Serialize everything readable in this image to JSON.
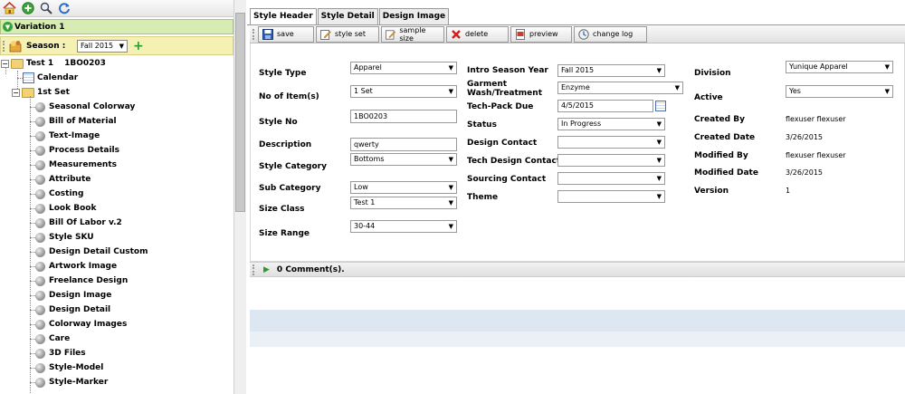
{
  "nav": {
    "icons": [
      "home-icon",
      "add-icon",
      "search-icon",
      "refresh-icon"
    ],
    "variation_label": "Variation 1",
    "season_label": "Season :",
    "season_value": "Fall 2015"
  },
  "tree": {
    "root_label": "Test 1",
    "root_code": "1BO0203",
    "calendar_label": "Calendar",
    "set_label": "1st Set",
    "items": [
      "Seasonal Colorway",
      "Bill of Material",
      "Text-Image",
      "Process Details",
      "Measurements",
      "Attribute",
      "Costing",
      "Look Book",
      "Bill Of Labor v.2",
      "Style SKU",
      "Design Detail Custom",
      "Artwork Image",
      "Freelance Design",
      "Design Image",
      "Design Detail",
      "Colorway Images",
      "Care",
      "3D Files",
      "Style-Model",
      "Style-Marker"
    ]
  },
  "tabs": [
    "Style Header",
    "Style Detail",
    "Design Image"
  ],
  "toolbar": {
    "save": "save",
    "style_set": "style set",
    "sample_size": "sample size",
    "delete": "delete",
    "preview": "preview",
    "change_log": "change log"
  },
  "form": {
    "col1": {
      "style_type": {
        "label": "Style Type",
        "value": "Apparel"
      },
      "no_items": {
        "label": "No of Item(s)",
        "value": "1 Set"
      },
      "style_no": {
        "label": "Style No",
        "value": "1BO0203"
      },
      "description": {
        "label": "Description",
        "value": "qwerty"
      },
      "style_category": {
        "label": "Style Category",
        "value": "Bottoms"
      },
      "sub_category": {
        "label": "Sub Category",
        "value": "Low"
      },
      "size_class": {
        "label": "Size Class",
        "value": "Test 1"
      },
      "size_range": {
        "label": "Size Range",
        "value": "30-44"
      }
    },
    "col2": {
      "intro_season_year": {
        "label": "Intro Season Year",
        "value": "Fall 2015"
      },
      "garment_wash_line1": "Garment",
      "garment_wash_line2": "Wash/Treatment",
      "garment_wash_value": "Enzyme",
      "tech_pack_due": {
        "label": "Tech-Pack Due",
        "value": "4/5/2015"
      },
      "status": {
        "label": "Status",
        "value": "In Progress"
      },
      "design_contact": {
        "label": "Design Contact",
        "value": ""
      },
      "tech_design_contact": {
        "label": "Tech Design Contact",
        "value": ""
      },
      "sourcing_contact": {
        "label": "Sourcing Contact",
        "value": ""
      },
      "theme": {
        "label": "Theme",
        "value": ""
      }
    },
    "col3": {
      "division": {
        "label": "Division",
        "value": "Yunique Apparel"
      },
      "active": {
        "label": "Active",
        "value": "Yes"
      },
      "created_by": {
        "label": "Created By",
        "value": "flexuser flexuser"
      },
      "created_date": {
        "label": "Created Date",
        "value": "3/26/2015"
      },
      "modified_by": {
        "label": "Modified By",
        "value": "flexuser flexuser"
      },
      "modified_date": {
        "label": "Modified Date",
        "value": "3/26/2015"
      },
      "version": {
        "label": "Version",
        "value": "1"
      }
    }
  },
  "comments": {
    "label": "0 Comment(s)."
  },
  "colors": {
    "variation_bg": "#d7ecb3",
    "season_bg": "#f4f1b2",
    "stripe_blue": "#dde7f1"
  }
}
